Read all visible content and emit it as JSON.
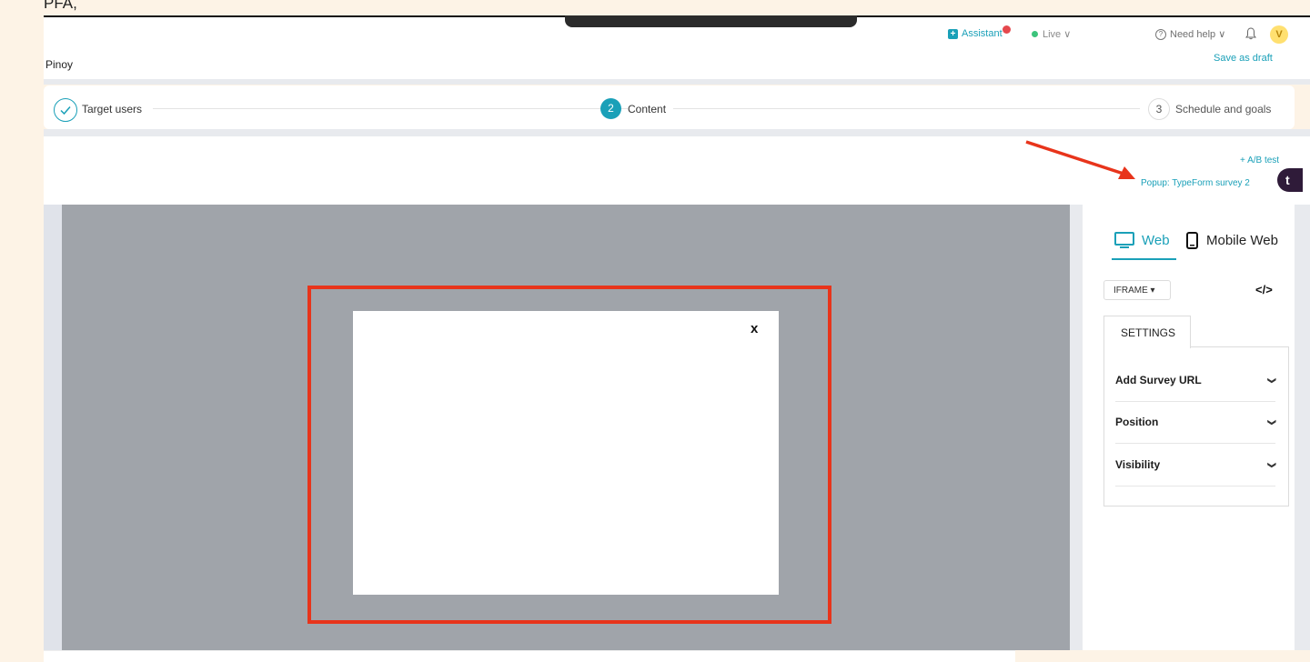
{
  "caption": "PFA,",
  "topbar": {
    "assistant_label": "Assistant",
    "live_label": "Live ∨",
    "help_label": "Need help ∨",
    "avatar_initial": "V"
  },
  "page": {
    "name": "Pinoy",
    "save_draft": "Save as draft"
  },
  "steps": [
    {
      "label": "Target users",
      "state": "done"
    },
    {
      "number": "2",
      "label": "Content",
      "state": "active"
    },
    {
      "number": "3",
      "label": "Schedule and goals",
      "state": "pending"
    }
  ],
  "content_header": {
    "ab_test": "+ A/B test",
    "variant": "Popup: TypeForm survey 2",
    "brand_badge": "t"
  },
  "popup": {
    "close_label": "x"
  },
  "side_panel": {
    "tabs": [
      {
        "label": "Web",
        "active": true
      },
      {
        "label": "Mobile Web",
        "active": false
      }
    ],
    "type_select": "IFRAME ▾",
    "code_icon": "</>",
    "settings_tab": "SETTINGS",
    "accordion": [
      {
        "label": "Add Survey URL"
      },
      {
        "label": "Position"
      },
      {
        "label": "Visibility"
      }
    ]
  },
  "colors": {
    "accent": "#1aa0b8",
    "annotation_red": "#e8341b",
    "preview_bg": "#a0a4aa",
    "page_bg": "#fdf3e6"
  }
}
